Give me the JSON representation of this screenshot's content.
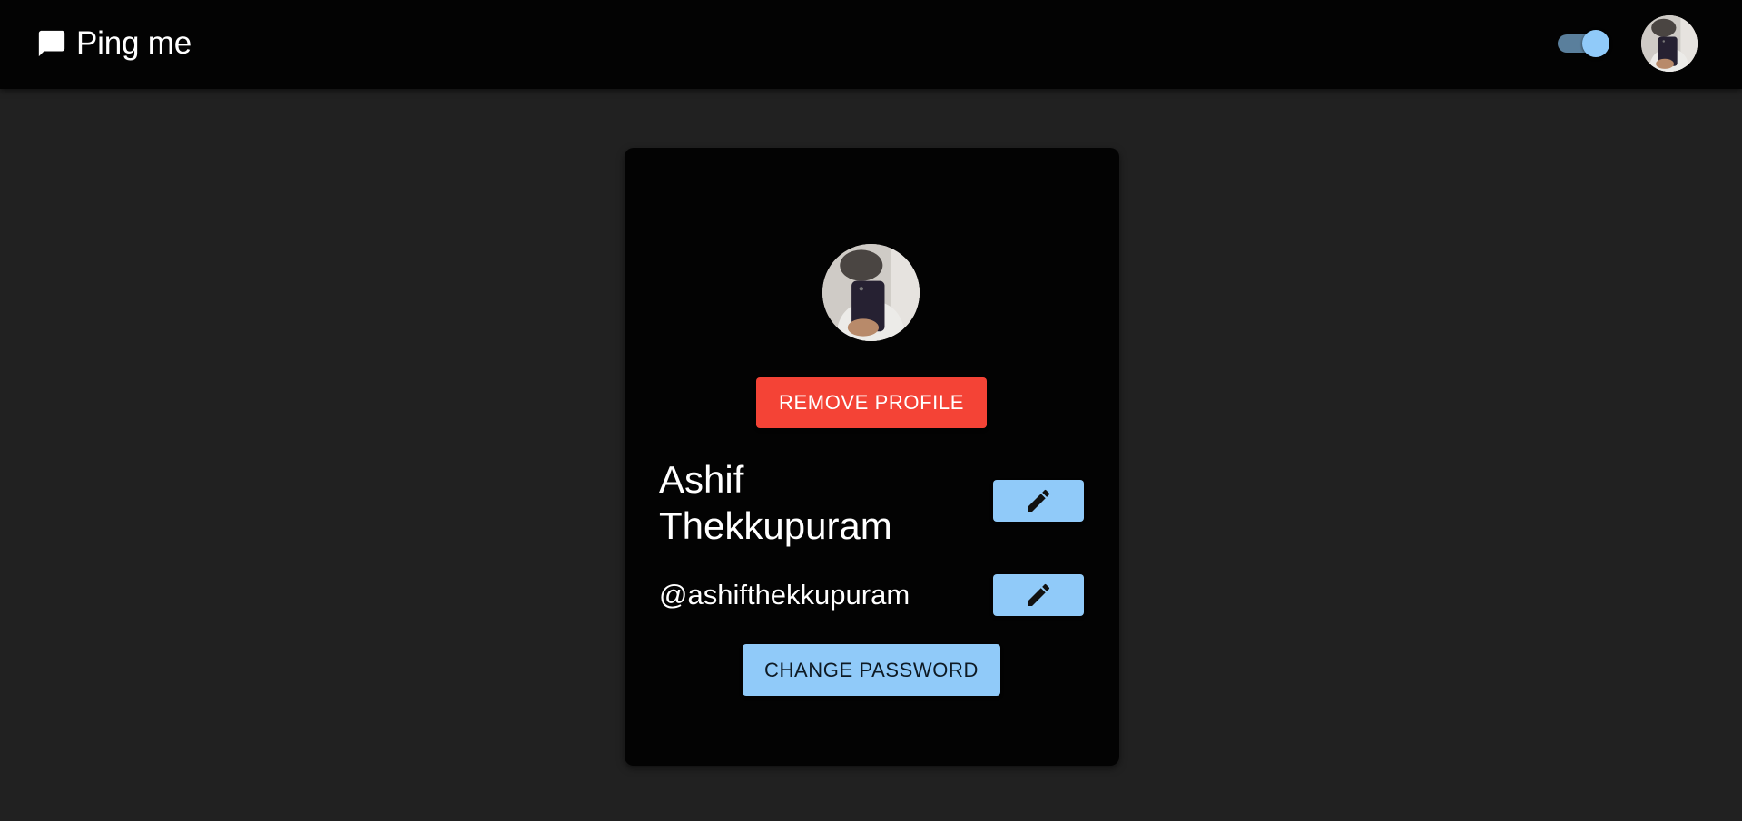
{
  "app": {
    "title": "Ping me",
    "brand_icon": "chat-icon"
  },
  "header": {
    "theme_toggle": {
      "checked": true,
      "icon": "toggle"
    },
    "user_avatar": {
      "icon": "avatar"
    }
  },
  "profile": {
    "avatar": {
      "icon": "avatar"
    },
    "remove_label": "REMOVE PROFILE",
    "name": "Ashif Thekkupuram",
    "username": "@ashifthekkupuram",
    "edit_icon": "pencil-icon",
    "change_password_label": "CHANGE PASSWORD"
  },
  "colors": {
    "background": "#212121",
    "surface": "#030303",
    "primary": "#90caf9",
    "danger": "#f44336",
    "text": "#ffffff"
  }
}
